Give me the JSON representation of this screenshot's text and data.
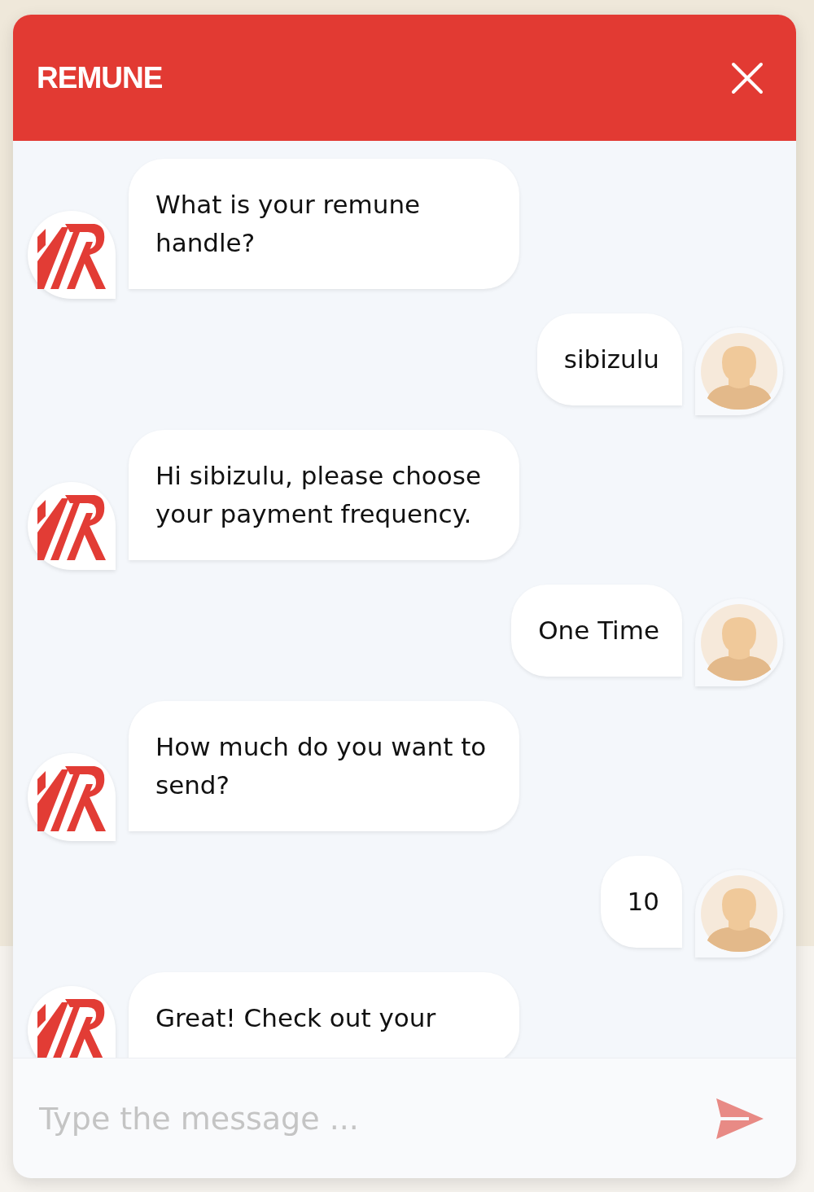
{
  "header": {
    "title": "REMUNE"
  },
  "messages": [
    {
      "kind": "bot",
      "text": "What is your remune handle?"
    },
    {
      "kind": "user",
      "text": "sibizulu"
    },
    {
      "kind": "bot",
      "text": "Hi sibizulu, please choose your payment frequency."
    },
    {
      "kind": "user",
      "text": "One Time"
    },
    {
      "kind": "bot",
      "text": "How much do you want to send?"
    },
    {
      "kind": "user",
      "text": "10"
    },
    {
      "kind": "bot",
      "text": "Great! Check out your"
    }
  ],
  "composer": {
    "placeholder": "Type the message ..."
  }
}
